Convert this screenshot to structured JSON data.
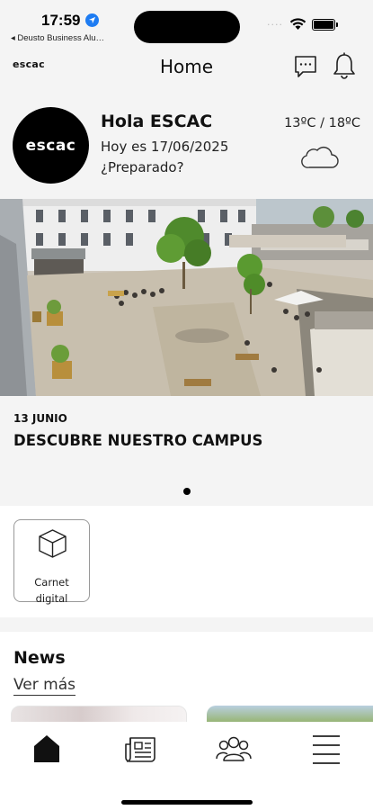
{
  "status_bar": {
    "time": "17:59",
    "back_app": "◂ Deusto Business Alu…",
    "signal": "····"
  },
  "header": {
    "brand": "escac",
    "title": "Home"
  },
  "greeting": {
    "logo_text": "escac",
    "hello": "Hola ESCAC",
    "date_line": "Hoy es 17/06/2025",
    "ready": "¿Preparado?",
    "temperature": "13ºC / 18ºC",
    "weather_icon": "cloud-icon"
  },
  "hero": {
    "date": "13 JUNIO",
    "title": "DESCUBRE NUESTRO CAMPUS",
    "carousel_count": 1,
    "carousel_active": 0
  },
  "quick_actions": [
    {
      "label_line1": "Carnet",
      "label_line2": "digital",
      "icon": "cube-icon"
    }
  ],
  "news": {
    "title": "News",
    "more": "Ver más"
  },
  "bottom_nav": [
    {
      "name": "home",
      "icon": "home-icon",
      "active": true
    },
    {
      "name": "news",
      "icon": "newspaper-icon",
      "active": false
    },
    {
      "name": "community",
      "icon": "people-icon",
      "active": false
    },
    {
      "name": "menu",
      "icon": "menu-icon",
      "active": false
    }
  ],
  "colors": {
    "background": "#f4f4f4",
    "surface": "#ffffff",
    "text": "#111111",
    "location_accent": "#1e7cf2"
  }
}
